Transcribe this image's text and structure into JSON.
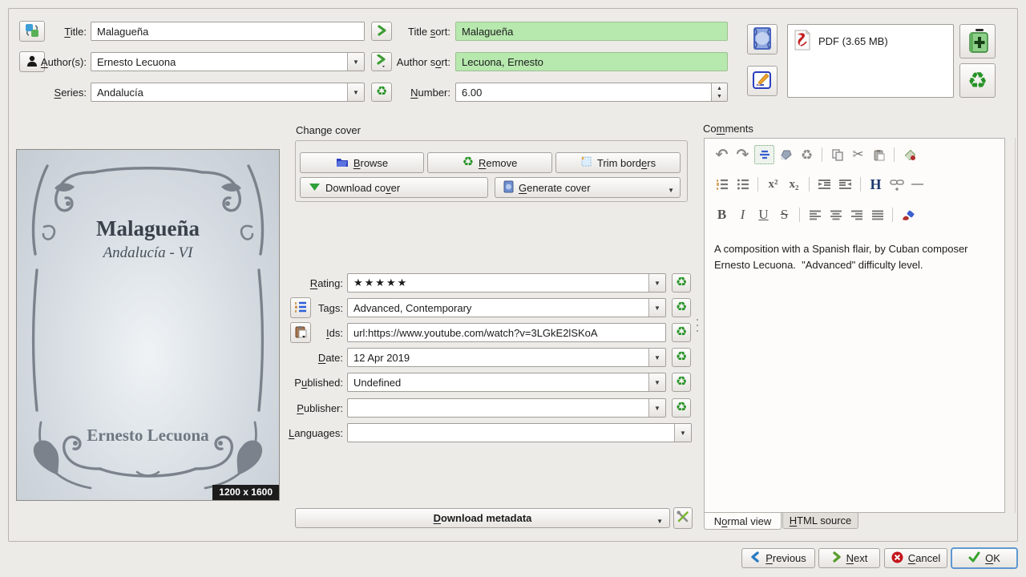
{
  "dialog": {
    "bg_color": "#edebe7",
    "sort_field_green": "#b7e8ae",
    "accent_green": "#2f9e2f",
    "focus_blue": "#4f94d0"
  },
  "top_form": {
    "title_label": "&Title:",
    "title_value": "Malagueña",
    "author_label": "&Author(s):",
    "author_value": "Ernesto Lecuona",
    "series_label": "&Series:",
    "series_value": "Andalucía",
    "title_sort_label": "Title &sort:",
    "title_sort_value": "Malagueña",
    "author_sort_label": "Author s&ort:",
    "author_sort_value": "Lecuona, Ernesto",
    "number_label": "&Number:",
    "number_value": "6.00"
  },
  "formats": {
    "items": [
      {
        "label": "PDF (3.65 MB)",
        "icon": "pdf-file-icon"
      }
    ]
  },
  "cover": {
    "title": "Malagueña",
    "series_line": "Andalucía - VI",
    "author": "Ernesto Lecuona",
    "size_badge": "1200 x 1600"
  },
  "change_cover": {
    "group_label": "Change cover",
    "browse_label": "&Browse",
    "remove_label": "&Remove",
    "trim_label": "Trim bord&ers",
    "download_label": "Download co&ver",
    "generate_label": "&Generate cover"
  },
  "metadata_fields": {
    "rating_label": "&Rating:",
    "rating_value": "★★★★★",
    "tags_label": "Ta&gs:",
    "tags_value": "Advanced, Contemporary",
    "ids_label": "&Ids:",
    "ids_value": "url:https://www.youtube.com/watch?v=3LGkE2lSKoA",
    "date_label": "&Date:",
    "date_value": "12 Apr 2019",
    "published_label": "P&ublished:",
    "published_value": "Undefined",
    "publisher_label": "&Publisher:",
    "publisher_value": "",
    "languages_label": "&Languages:",
    "languages_value": ""
  },
  "download_metadata_label": "&Download metadata",
  "comments": {
    "label": "Co&mments",
    "text": "A composition with a Spanish flair, by Cuban composer Ernesto Lecuona.  \"Advanced\" difficulty level.",
    "glyphs": {
      "superscript": "x²",
      "subscript": "x₂",
      "heading": "H",
      "bold": "B",
      "italic": "I",
      "underline": "U",
      "strike": "S"
    },
    "tabs": [
      {
        "label": "N&ormal view"
      },
      {
        "label": "&HTML source"
      }
    ]
  },
  "footer": {
    "previous_label": "&Previous",
    "next_label": "&Next",
    "cancel_label": "&Cancel",
    "ok_label": "&OK"
  }
}
